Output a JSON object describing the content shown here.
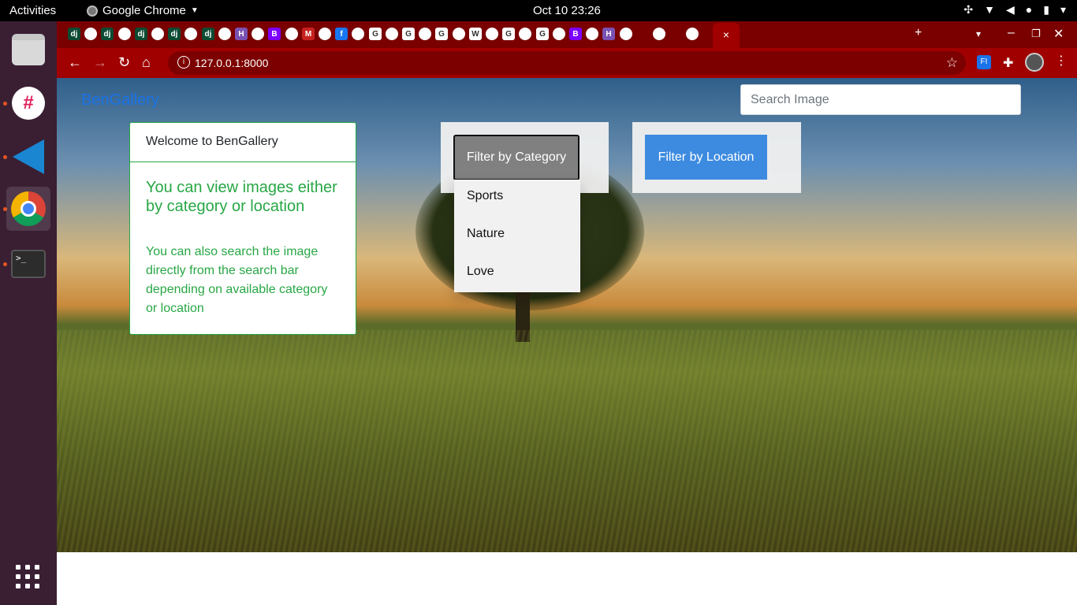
{
  "os": {
    "activities": "Activities",
    "app_name": "Google Chrome",
    "clock": "Oct 10  23:26"
  },
  "dock": {
    "items": [
      "files",
      "slack",
      "vscode",
      "chrome",
      "terminal"
    ],
    "terminal_prompt": ">_"
  },
  "browser": {
    "url": "127.0.0.1:8000",
    "active_tab_close": "×",
    "extension_label": "FI",
    "tab_favicons": [
      "dj",
      "dj",
      "dj",
      "dj",
      "dj",
      "H",
      "B",
      "M",
      "f",
      "G",
      "G",
      "G",
      "W",
      "G",
      "G",
      "B",
      "H"
    ]
  },
  "page": {
    "brand": "BenGallery",
    "search_placeholder": "Search Image",
    "welcome": {
      "header": "Welcome to BenGallery",
      "lead": "You can view images either by category or location",
      "body": "You can also search the image directly from the search bar depending on available category or location"
    },
    "filter_category": {
      "label": "Filter by Category",
      "options": [
        "Sports",
        "Nature",
        "Love"
      ]
    },
    "filter_location": {
      "label": "Filter by Location"
    }
  },
  "colors": {
    "brand": "#1a73e8",
    "success": "#28a745",
    "location_button": "#3d8be0",
    "category_button": "#808080",
    "chrome_frame": "#a00000"
  }
}
